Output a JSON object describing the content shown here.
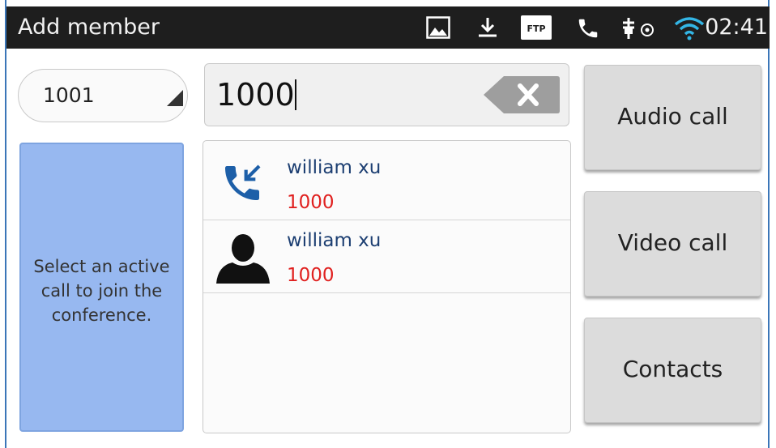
{
  "statusbar": {
    "title": "Add member",
    "time": "02:41",
    "ftp_label": "FTP",
    "icons": [
      "image-icon",
      "download-icon",
      "ftp-icon",
      "phone-icon",
      "usb-debug-icon",
      "wifi-icon"
    ]
  },
  "account": {
    "value": "1001"
  },
  "search": {
    "value": "1000"
  },
  "info": {
    "message": "Select an active call to join the conference."
  },
  "results": [
    {
      "name": "william xu",
      "number": "1000",
      "icon": "incoming-call-icon"
    },
    {
      "name": "william xu",
      "number": "1000",
      "icon": "contact-avatar-icon"
    }
  ],
  "actions": {
    "audio_call": "Audio call",
    "video_call": "Video call",
    "contacts": "Contacts"
  },
  "colors": {
    "statusbar_bg": "#1e1e1e",
    "name_text": "#1d3f72",
    "number_text": "#e0201f",
    "info_panel": "#97b8f0",
    "call_icon": "#1d5fa8"
  }
}
